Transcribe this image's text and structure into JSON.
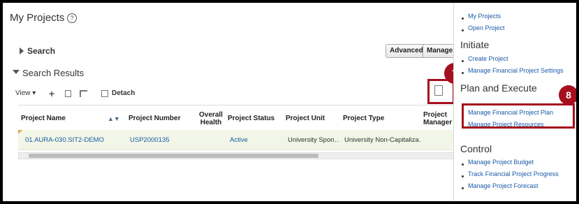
{
  "page": {
    "title": "My Projects",
    "help": "?"
  },
  "search": {
    "label": "Search",
    "advanced": "Advanced",
    "manage": "Manage W"
  },
  "results": {
    "label": "Search Results"
  },
  "toolbar": {
    "view": "View ▾",
    "detach": "Detach"
  },
  "columns": [
    "Project Name",
    "Project Number",
    "Overall Health",
    "Project Status",
    "Project Unit",
    "Project Type",
    "Project Manager"
  ],
  "rows": [
    {
      "name": "01.AURA-030.SIT2-DEMO",
      "number": "USP2000135",
      "health": "",
      "status": "Active",
      "unit": "University Spon…",
      "type": "University Non-Capitaliza…"
    }
  ],
  "callouts": [
    "7",
    "8"
  ],
  "panel": {
    "top_links": [
      "My Projects",
      "Open Project"
    ],
    "initiate": {
      "title": "Initiate",
      "links": [
        "Create Project",
        "Manage Financial Project Settings"
      ]
    },
    "plan": {
      "title": "Plan and Execute",
      "links": [
        "Manage Financial Project Plan",
        "Manage Project Resources"
      ]
    },
    "control": {
      "title": "Control",
      "links": [
        "Manage Project Budget",
        "Track Financial Project Progress",
        "Manage Project Forecast"
      ]
    }
  }
}
